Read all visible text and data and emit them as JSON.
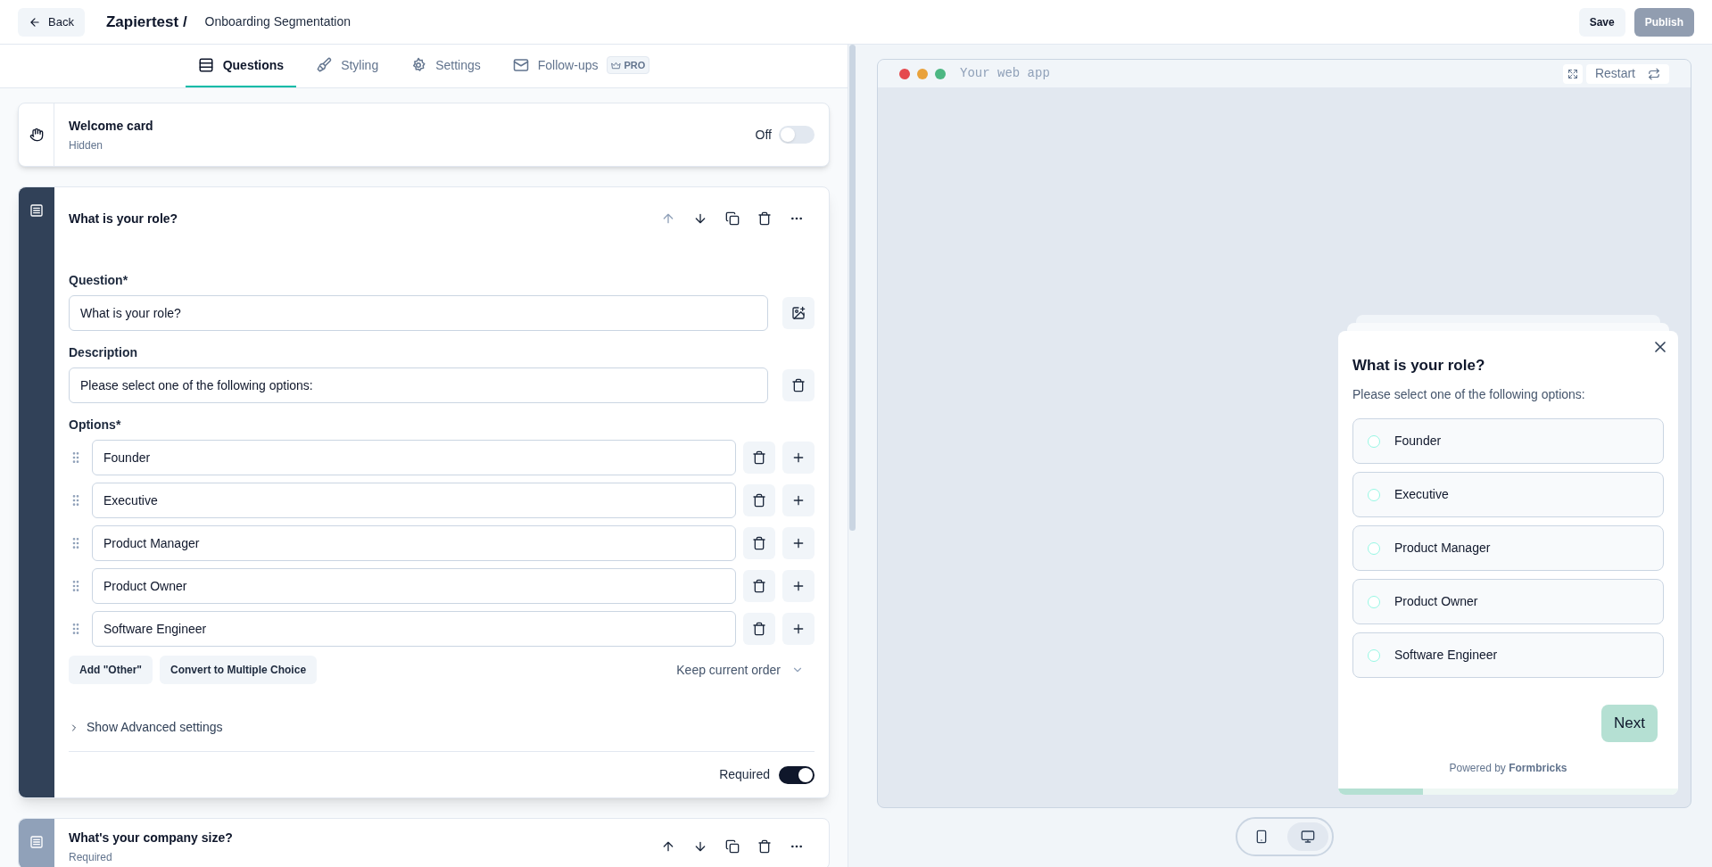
{
  "header": {
    "back": "Back",
    "workspace": "Zapiertest /",
    "survey_name": "Onboarding Segmentation",
    "save": "Save",
    "publish": {
      "label": "Publish",
      "disabled": true
    }
  },
  "tabs": [
    {
      "kind": "questions",
      "label": "Questions",
      "selected": true
    },
    {
      "kind": "styling",
      "label": "Styling",
      "selected": false
    },
    {
      "kind": "settings",
      "label": "Settings",
      "selected": false
    },
    {
      "kind": "followups",
      "label": "Follow-ups",
      "selected": false,
      "badge": "PRO"
    }
  ],
  "welcome_card": {
    "title": "Welcome card",
    "subtitle": "Hidden",
    "toggle_label": "Off",
    "on": false
  },
  "questions": [
    {
      "title": "What is your role?",
      "expanded": true,
      "question_label": "Question*",
      "question_value": "What is your role?",
      "description_label": "Description",
      "description_value": "Please select one of the following options:",
      "options_label": "Options*",
      "options": [
        "Founder",
        "Executive",
        "Product Manager",
        "Product Owner",
        "Software Engineer"
      ],
      "buttons": [
        "Add \"Other\"",
        "Convert to Multiple Choice"
      ],
      "order": "Keep current order",
      "advanced": "Show Advanced settings",
      "required_label": "Required",
      "required": true
    },
    {
      "title": "What's your company size?",
      "expanded": false,
      "subtitle": "Required"
    }
  ],
  "preview": {
    "url": "Your web app",
    "restart": "Restart",
    "survey": {
      "title": "What is your role?",
      "description": "Please select one of the following options:",
      "options": [
        {
          "label": "Founder",
          "selected": false
        },
        {
          "label": "Executive",
          "selected": false
        },
        {
          "label": "Product Manager",
          "selected": false
        },
        {
          "label": "Product Owner",
          "selected": false
        },
        {
          "label": "Software Engineer",
          "selected": false
        }
      ],
      "next": "Next",
      "powered_by": "Powered by **Formbricks**",
      "progress": {
        "level": 0.25
      }
    },
    "devices": [
      {
        "kind": "mobile",
        "selected": false
      },
      {
        "kind": "desktop",
        "selected": true
      }
    ]
  }
}
